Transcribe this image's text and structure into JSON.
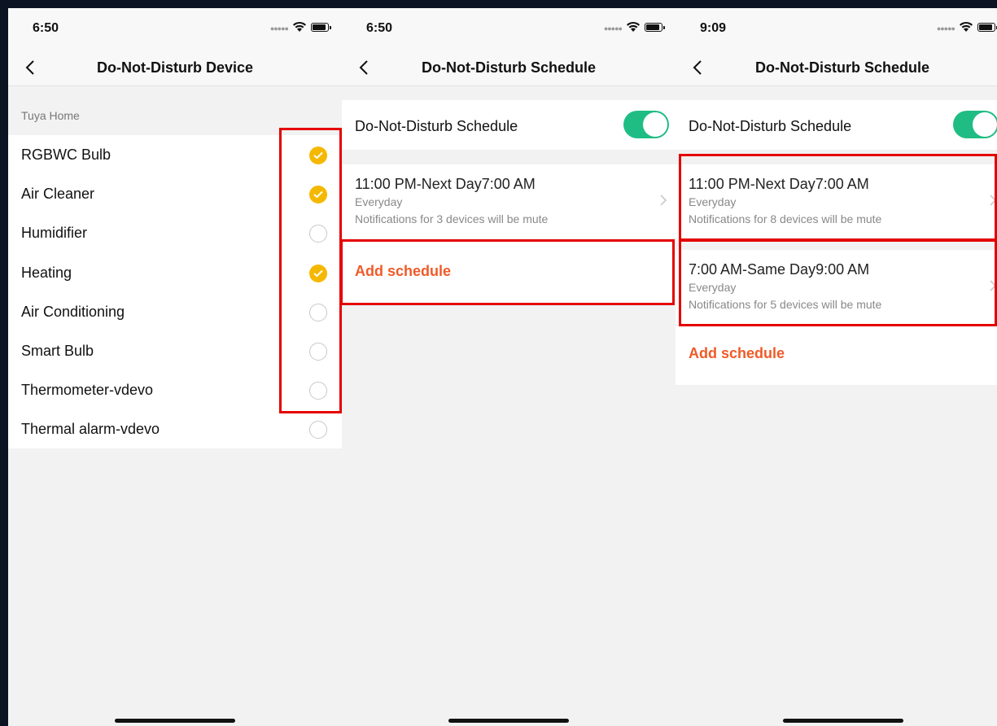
{
  "colors": {
    "accent_orange": "#f05a28",
    "toggle_green": "#1fbd84",
    "check_yellow": "#f5b800",
    "highlight_red": "#e50000"
  },
  "screen1": {
    "status_time": "6:50",
    "title": "Do-Not-Disturb Device",
    "section_label": "Tuya Home",
    "devices": [
      {
        "name": "RGBWC Bulb",
        "checked": true
      },
      {
        "name": "Air Cleaner",
        "checked": true
      },
      {
        "name": "Humidifier",
        "checked": false
      },
      {
        "name": "Heating",
        "checked": true
      },
      {
        "name": "Air Conditioning",
        "checked": false
      },
      {
        "name": "Smart Bulb",
        "checked": false
      },
      {
        "name": "Thermometer-vdevo",
        "checked": false
      },
      {
        "name": "Thermal alarm-vdevo",
        "checked": false
      }
    ]
  },
  "screen2": {
    "status_time": "6:50",
    "title": "Do-Not-Disturb Schedule",
    "toggle_label": "Do-Not-Disturb Schedule",
    "toggle_on": true,
    "schedules": [
      {
        "time": "11:00 PM-Next Day7:00 AM",
        "frequency": "Everyday",
        "note": "Notifications for 3 devices will be mute"
      }
    ],
    "add_label": "Add schedule"
  },
  "screen3": {
    "status_time": "9:09",
    "title": "Do-Not-Disturb Schedule",
    "toggle_label": "Do-Not-Disturb Schedule",
    "toggle_on": true,
    "schedules": [
      {
        "time": "11:00 PM-Next Day7:00 AM",
        "frequency": "Everyday",
        "note": "Notifications for 8 devices will be mute"
      },
      {
        "time": "7:00 AM-Same Day9:00 AM",
        "frequency": "Everyday",
        "note": "Notifications for 5 devices will be mute"
      }
    ],
    "add_label": "Add schedule"
  }
}
